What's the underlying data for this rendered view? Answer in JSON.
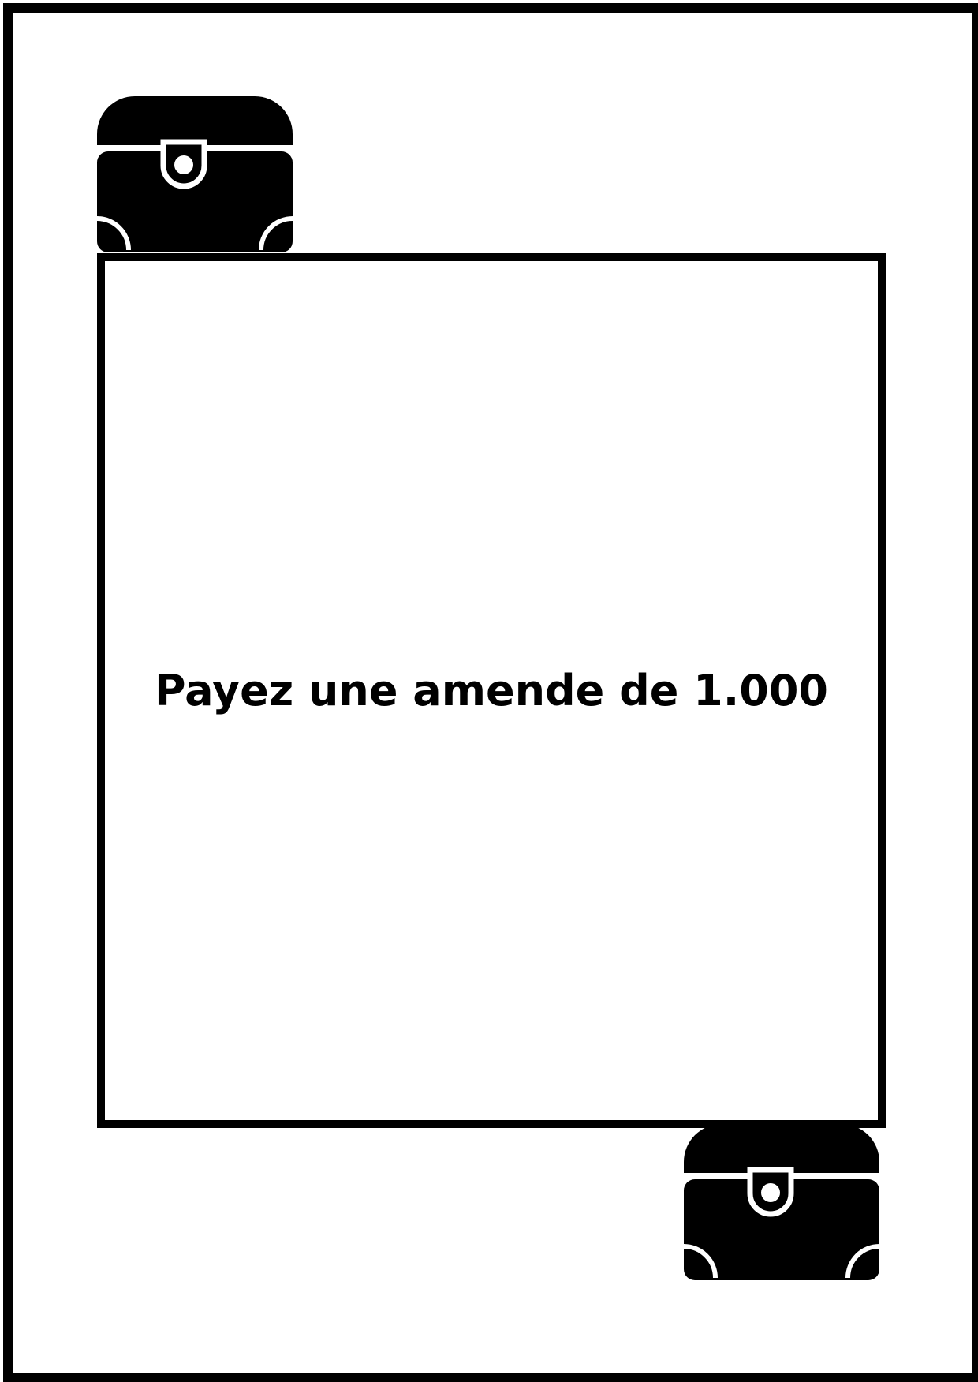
{
  "card": {
    "text": "Payez une amende de 1.000",
    "icons": [
      "treasure-chest-icon",
      "treasure-chest-icon"
    ],
    "colors": {
      "background": "#ffffff",
      "ink": "#000000"
    }
  }
}
